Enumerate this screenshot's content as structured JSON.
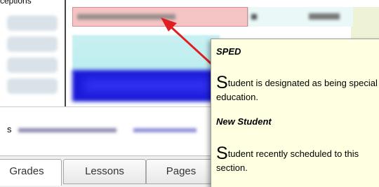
{
  "page": {
    "top_label": "ceptions"
  },
  "tabs": [
    {
      "label": "Grades"
    },
    {
      "label": "Lessons"
    },
    {
      "label": "Pages"
    }
  ],
  "mid_bar": {
    "letter": "s"
  },
  "tooltip": {
    "sped_heading": "SPED",
    "sped_initial": "S",
    "sped_text": "tudent is designated as being special education.",
    "new_heading": "New Student",
    "new_initial": "S",
    "new_text": "tudent recently scheduled to this section."
  },
  "colors": {
    "tooltip_background": "#ffffe1",
    "sped_row": "#f5c4c4",
    "arrow": "#e02020",
    "highlight_row": "#1a1ad8",
    "teal_row": "#c8f0f2"
  },
  "icons": {
    "annotation_arrow": "red-arrow-icon"
  }
}
